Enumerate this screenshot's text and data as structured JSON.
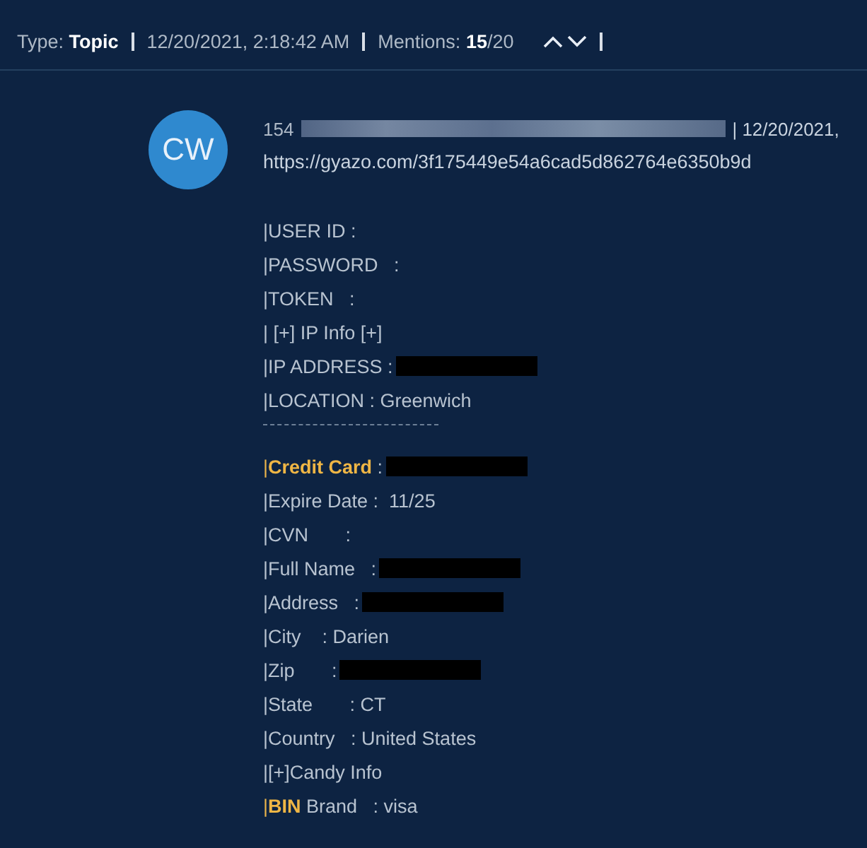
{
  "header": {
    "type_label": "Type:",
    "type_value": "Topic",
    "timestamp": "12/20/2021, 2:18:42 AM",
    "mentions_label": "Mentions:",
    "mentions_current": "15",
    "mentions_total": "/20"
  },
  "post": {
    "avatar": "CW",
    "author_number": "154",
    "author_blurred": true,
    "date": "| 12/20/2021,",
    "link": "https://gyazo.com/3f175449e54a6cad5d862764e6350b9d",
    "lines": [
      {
        "text": "|USER ID :"
      },
      {
        "text": "|PASSWORD   :"
      },
      {
        "text": "|TOKEN   :"
      },
      {
        "text": "| [+] IP Info [+]"
      },
      {
        "text": "|IP ADDRESS :",
        "redacted": true
      },
      {
        "text": "|LOCATION : Greenwich"
      },
      {
        "kind": "rule"
      },
      {
        "prefix": "|",
        "highlight": "Credit Card",
        "text": " :",
        "redacted": true
      },
      {
        "text": "|Expire Date :  11/25"
      },
      {
        "text": "|CVN       :"
      },
      {
        "text": "|Full Name   :",
        "redacted": true
      },
      {
        "text": "|Address   :",
        "redacted": true
      },
      {
        "text": "|City    : Darien"
      },
      {
        "text": "|Zip       :",
        "redacted": true
      },
      {
        "text": "|State       : CT"
      },
      {
        "text": "|Country   : United States"
      },
      {
        "text": "|[+]Candy Info"
      },
      {
        "prefix": "|",
        "highlight": "BIN",
        "text": " Brand   : visa"
      }
    ]
  }
}
